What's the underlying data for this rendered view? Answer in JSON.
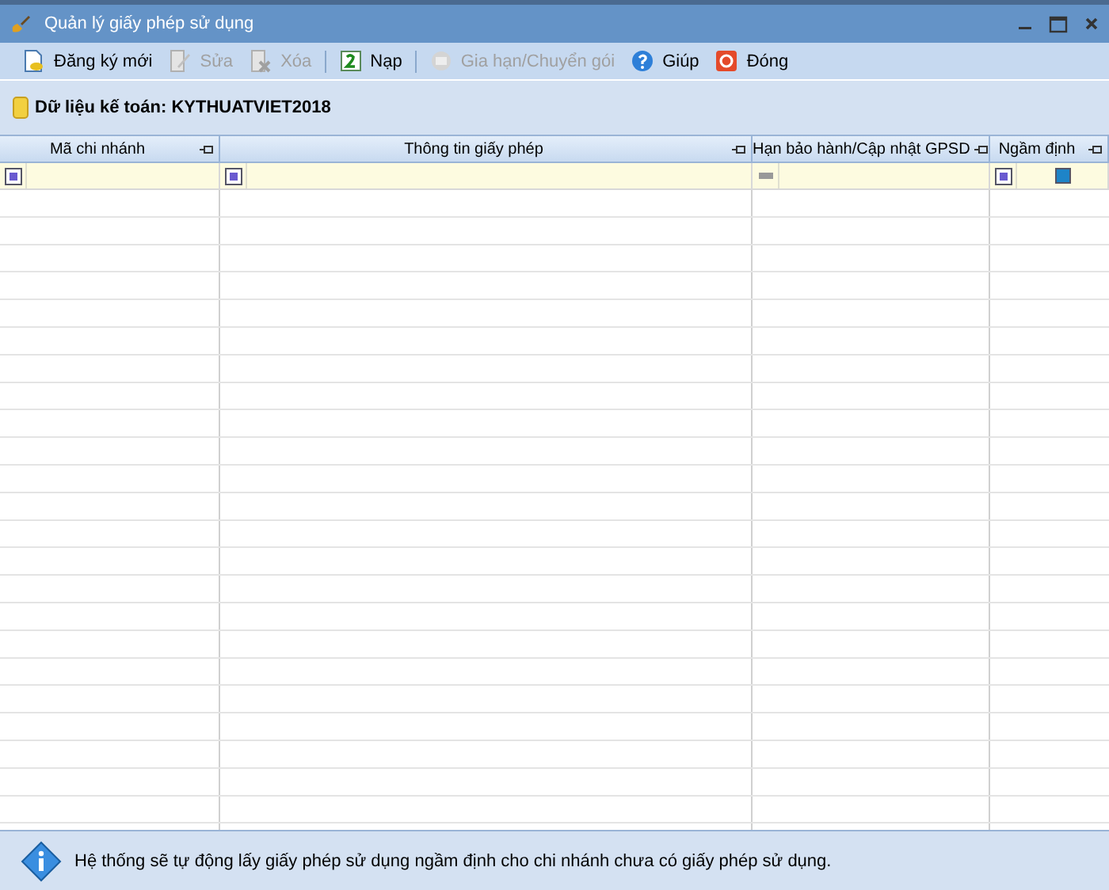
{
  "window": {
    "title": "Quản lý giấy phép sử dụng"
  },
  "toolbar": [
    {
      "kind": "new",
      "label": "Đăng ký mới",
      "disabled": false
    },
    {
      "kind": "edit",
      "label": "Sửa",
      "disabled": true
    },
    {
      "kind": "delete",
      "label": "Xóa",
      "disabled": true
    },
    {
      "kind": "separator"
    },
    {
      "kind": "reload",
      "label": "Nạp",
      "disabled": false
    },
    {
      "kind": "separator"
    },
    {
      "kind": "renew",
      "label": "Gia hạn/Chuyển gói",
      "disabled": true
    },
    {
      "kind": "help",
      "label": "Giúp",
      "disabled": false
    },
    {
      "kind": "close",
      "label": "Đóng",
      "disabled": false
    }
  ],
  "database": {
    "label": "Dữ liệu kế toán: KYTHUATVIET2018"
  },
  "table": {
    "columns": [
      {
        "label": "Mã chi nhánh",
        "kind": "text"
      },
      {
        "label": "Thông tin giấy phép",
        "kind": "text"
      },
      {
        "label": "Hạn bảo hành/Cập nhật GPSD",
        "kind": "date"
      },
      {
        "label": "Ngầm định",
        "kind": "flag"
      }
    ]
  },
  "status_bar": {
    "message": "Hệ thống sẽ tự động lấy giấy phép sử dụng ngầm định cho chi nhánh chưa có giấy phép sử dụng."
  }
}
